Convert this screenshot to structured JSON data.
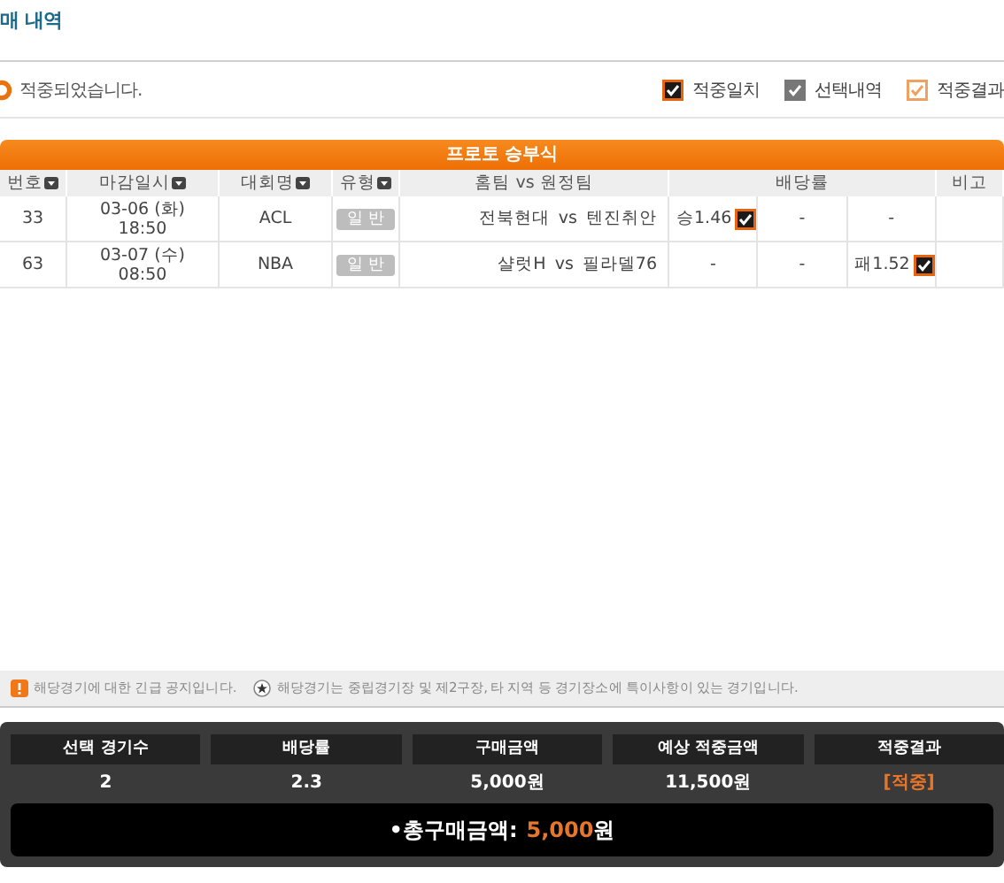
{
  "title": "매 내역",
  "status": {
    "text": "적중되었습니다."
  },
  "legend": [
    {
      "kind": "hit",
      "label": "적중일치"
    },
    {
      "kind": "selected",
      "label": "선택내역"
    },
    {
      "kind": "result",
      "label": "적중결과"
    }
  ],
  "table": {
    "title": "프로토 승부식",
    "columns": [
      {
        "label": "번호",
        "sortable": true
      },
      {
        "label": "마감일시",
        "sortable": true
      },
      {
        "label": "대회명",
        "sortable": true
      },
      {
        "label": "유형",
        "sortable": true
      },
      {
        "label": "홈팀 vs 원정팀",
        "sortable": false
      },
      {
        "label": "배당률",
        "sortable": false
      },
      {
        "label": "비고",
        "sortable": false
      }
    ],
    "rows": [
      {
        "number": "33",
        "date": "03-06 (화)",
        "time": "18:50",
        "league": "ACL",
        "type": "일 반",
        "home": "전북현대",
        "vs": "vs",
        "away": "텐진취안",
        "odds": [
          {
            "text": "승1.46",
            "checked": true
          },
          {
            "text": "-",
            "checked": false
          },
          {
            "text": "-",
            "checked": false
          }
        ]
      },
      {
        "number": "63",
        "date": "03-07 (수)",
        "time": "08:50",
        "league": "NBA",
        "type": "일 반",
        "home": "샬럿H",
        "vs": "vs",
        "away": "필라델76",
        "odds": [
          {
            "text": "-",
            "checked": false
          },
          {
            "text": "-",
            "checked": false
          },
          {
            "text": "패1.52",
            "checked": true
          }
        ]
      }
    ]
  },
  "notices": [
    {
      "kind": "alert",
      "text": "해당경기에 대한 긴급 공지입니다."
    },
    {
      "kind": "star",
      "text": "해당경기는 중립경기장 및 제2구장, 타 지역 등 경기장소에 특이사항이 있는 경기입니다."
    }
  ],
  "summary": {
    "columns": [
      {
        "label": "선택 경기수",
        "value": "2",
        "highlight": false
      },
      {
        "label": "배당률",
        "value": "2.3",
        "highlight": false
      },
      {
        "label": "구매금액",
        "value": "5,000원",
        "highlight": false
      },
      {
        "label": "예상 적중금액",
        "value": "11,500원",
        "highlight": false
      },
      {
        "label": "적중결과",
        "value": "[적중]",
        "highlight": true
      }
    ],
    "total_label": "•총구매금액:",
    "total_amount": "5,000",
    "total_unit": "원"
  }
}
